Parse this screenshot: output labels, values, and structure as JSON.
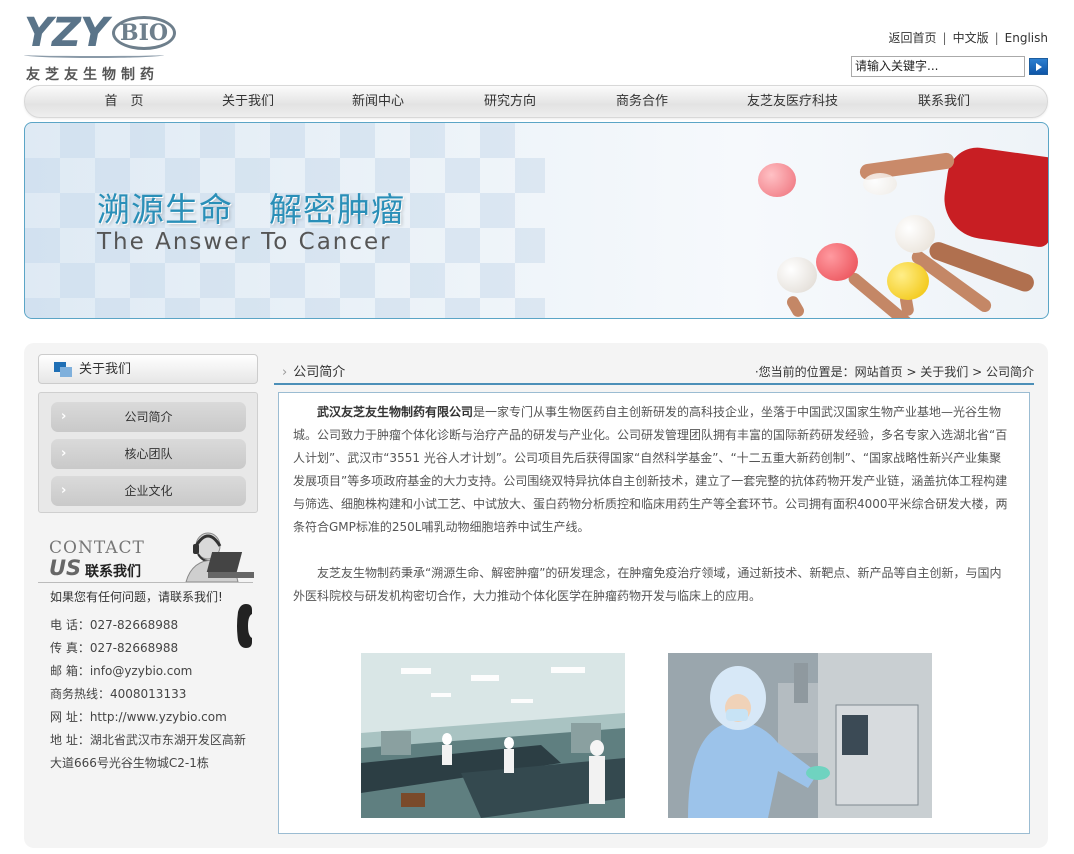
{
  "logo": {
    "brand": "YZY",
    "brand_suffix": "BIO",
    "company_cn": "友芝友生物制药"
  },
  "toplinks": [
    "返回首页",
    "中文版",
    "English"
  ],
  "toplinks_sep": "|",
  "search": {
    "placeholder": "请输入关键字..."
  },
  "nav": [
    "首　页",
    "关于我们",
    "新闻中心",
    "研究方向",
    "商务合作",
    "友芝友医疗科技",
    "联系我们"
  ],
  "banner": {
    "title_left": "溯源生命",
    "title_right": "解密肿瘤",
    "subtitle": "The Answer To Cancer"
  },
  "sidebar": {
    "title": "关于我们",
    "items": [
      {
        "label": "公司简介"
      },
      {
        "label": "核心团队"
      },
      {
        "label": "企业文化"
      }
    ],
    "contact_en_1": "CONTACT",
    "contact_en_2": "US",
    "contact_cn": "联系我们",
    "contact_intro": "如果您有任何问题，请联系我们!",
    "contact_lines": [
      "电 话：027-82668988",
      "传 真：027-82668988",
      "邮 箱：info@yzybio.com",
      "商务热线：4008013133",
      "网 址：http://www.yzybio.com",
      "地 址：湖北省武汉市东湖开发区高新",
      "大道666号光谷生物城C2-1栋"
    ]
  },
  "main": {
    "title": "公司简介",
    "breadcrumb": "·您当前的位置是：网站首页 > 关于我们 > 公司简介",
    "para1_lead": "武汉友芝友生物制药有限公司",
    "para1_body": "是一家专门从事生物医药自主创新研发的高科技企业，坐落于中国武汉国家生物产业基地—光谷生物城。公司致力于肿瘤个体化诊断与治疗产品的研发与产业化。公司研发管理团队拥有丰富的国际新药研发经验，多名专家入选湖北省“百人计划”、武汉市“3551 光谷人才计划”。公司项目先后获得国家“自然科学基金”、“十二五重大新药创制”、“国家战略性新兴产业集聚发展项目”等多项政府基金的大力支持。公司围绕双特异抗体自主创新技术，建立了一套完整的抗体药物开发产业链，涵盖抗体工程构建与筛选、细胞株构建和小试工艺、中试放大、蛋白药物分析质控和临床用药生产等全套环节。公司拥有面积4000平米综合研发大楼，两条符合GMP标准的250L哺乳动物细胞培养中试生产线。",
    "para2": "友芝友生物制药秉承“溯源生命、解密肿瘤”的研发理念，在肿瘤免疫治疗领域，通过新技术、新靶点、新产品等自主创新，与国内外医科院校与研发机构密切合作，大力推动个体化医学在肿瘤药物开发与临床上的应用。"
  },
  "colors": {
    "accent": "#2a8fb8",
    "rule": "#4c8fb8",
    "search_btn": "#1a66b8",
    "balloon_red": "#e8474f",
    "shirt": "#c81e23"
  },
  "icons": [
    "search-arrow-icon",
    "about-squares-icon",
    "chevron-right-icon",
    "operator-headset-icon",
    "telephone-icon"
  ]
}
